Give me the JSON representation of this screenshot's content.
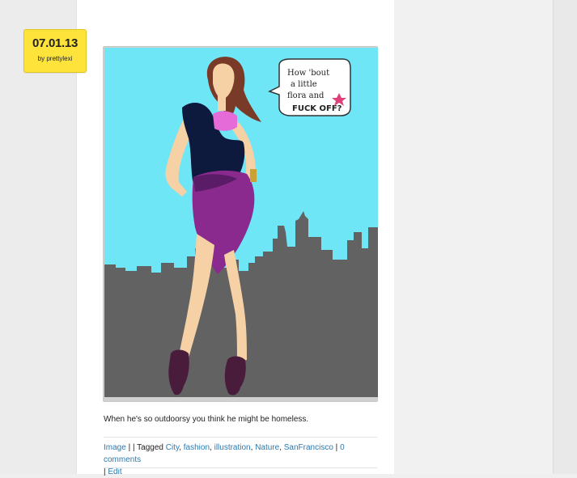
{
  "post": {
    "date": "07.01.13",
    "author_line": "by prettylexi",
    "caption": "When he's so outdoorsy you think he might be homeless.",
    "speech_bubble": [
      "How 'bout",
      "a little",
      "flora and",
      "FUCK OFF?"
    ]
  },
  "meta": {
    "format_link": "Image",
    "sep1": " | ",
    "sep2": "| Tagged ",
    "tags": [
      "City",
      "fashion",
      "illustration",
      "Nature",
      "SanFrancisco"
    ],
    "comma": ", ",
    "sep3": " | ",
    "comments_link": "0 comments",
    "sep4": "| ",
    "edit_link": "Edit"
  },
  "colors": {
    "badge": "#fde33a",
    "link": "#2a7ab0",
    "sky": "#6ee6f5",
    "skyline": "#626262",
    "dress": "#8a2a8e"
  }
}
